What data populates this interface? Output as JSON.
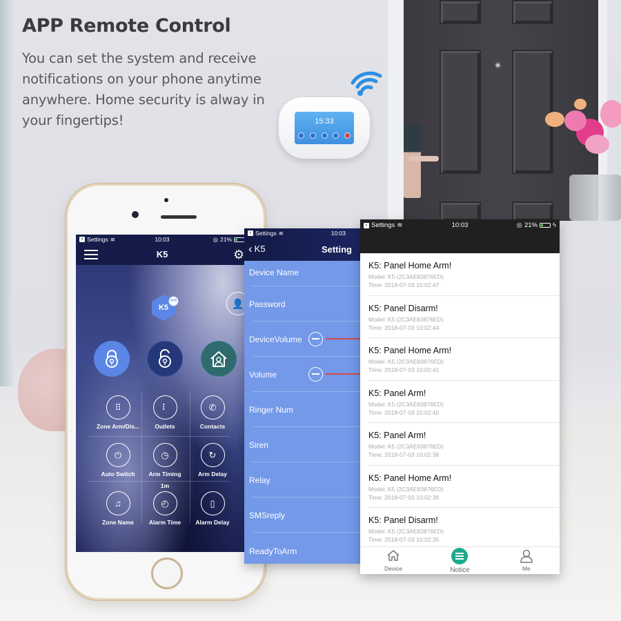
{
  "heading": {
    "title": "APP Remote Control",
    "body": "You can set the system and receive notifications on your phone anytime anywhere. Home security is alway in your fingertips!"
  },
  "device_panel": {
    "clock": "15:33",
    "icon": "wifi-icon"
  },
  "status_bar": {
    "back_app": "Settings",
    "time": "10:03",
    "battery": "21%"
  },
  "home_screen": {
    "title": "K5",
    "device_badge": "K5",
    "device_badge_sub": "Wifi",
    "modes": [
      {
        "name": "arm",
        "icon": "lock-closed-icon",
        "color": "#5b86e6"
      },
      {
        "name": "disarm",
        "icon": "lock-open-icon",
        "color": "#24387a"
      },
      {
        "name": "home-arm",
        "icon": "home-user-icon",
        "color": "#2e6a6e"
      }
    ],
    "tiles": [
      {
        "label": "Zone Arm/Dis...",
        "icon": "keypad-icon",
        "glyph": "⠿"
      },
      {
        "label": "Outlets",
        "icon": "outlet-icon",
        "glyph": "⠇"
      },
      {
        "label": "Contacts",
        "icon": "phone-icon",
        "glyph": "✆"
      },
      {
        "label": "Auto Switch",
        "icon": "power-icon",
        "glyph": "⏻"
      },
      {
        "label": "Arm Timing",
        "icon": "clock-icon",
        "glyph": "◷"
      },
      {
        "label": "Arm Delay",
        "icon": "delay-icon",
        "glyph": "↻"
      },
      {
        "label": "Zone Name",
        "icon": "bell-icon",
        "glyph": "🔔"
      },
      {
        "label": "Alarm Time",
        "icon": "alarm-clock-icon",
        "glyph": "◴",
        "value": "1m"
      },
      {
        "label": "Alarm Delay",
        "icon": "door-sensor-icon",
        "glyph": "▯"
      }
    ]
  },
  "settings_screen": {
    "back_label": "K5",
    "title": "Setting",
    "items": [
      {
        "label": "Device Name"
      },
      {
        "label": "Password"
      },
      {
        "label": "DeviceVolume",
        "control": "slider"
      },
      {
        "label": "Volume",
        "control": "slider"
      },
      {
        "label": "Ringer Num"
      },
      {
        "label": "Siren"
      },
      {
        "label": "Relay"
      },
      {
        "label": "SMSreply"
      },
      {
        "label": "ReadyToArm"
      }
    ]
  },
  "notice_screen": {
    "notices": [
      {
        "title": "K5: Panel Home Arm!",
        "model": "Model:  K5 (2C3AE83876ED)",
        "time": "Time:  2018-07-03 10:02:47"
      },
      {
        "title": "K5: Panel Disarm!",
        "model": "Model:  K5 (2C3AE83876ED)",
        "time": "Time:  2018-07-03 10:02:44"
      },
      {
        "title": "K5: Panel Home Arm!",
        "model": "Model:  K5 (2C3AE83876ED)",
        "time": "Time:  2018-07-03 10:02:41"
      },
      {
        "title": "K5: Panel Arm!",
        "model": "Model:  K5 (2C3AE83876ED)",
        "time": "Time:  2018-07-03 10:02:40"
      },
      {
        "title": "K5: Panel Arm!",
        "model": "Model:  K5 (2C3AE83876ED)",
        "time": "Time:  2018-07-03 10:02:38"
      },
      {
        "title": "K5: Panel Home Arm!",
        "model": "Model:  K5 (2C3AE83876ED)",
        "time": "Time:  2018-07-03 10:02:38"
      },
      {
        "title": "K5: Panel Disarm!",
        "model": "Model:  K5 (2C3AE83876ED)",
        "time": "Time:  2018-07-03 10:02:35"
      }
    ],
    "tabs": [
      {
        "label": "Device",
        "icon": "house-icon",
        "active": false
      },
      {
        "label": "Notice",
        "icon": "chat-bubble-icon",
        "active": true
      },
      {
        "label": "Me",
        "icon": "person-icon",
        "active": false
      }
    ],
    "accent": "#1fa98f"
  }
}
